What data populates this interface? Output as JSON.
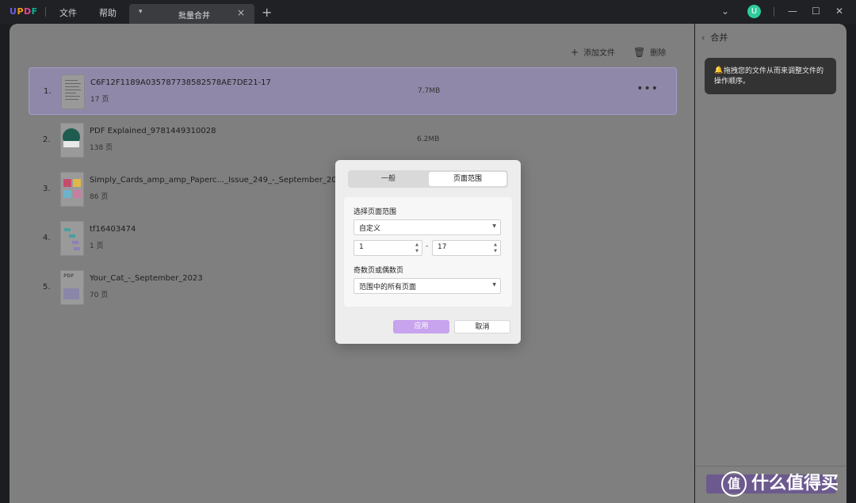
{
  "app": {
    "logo": "UPDF",
    "menus": [
      "文件",
      "帮助"
    ],
    "tab": {
      "title": "批量合并",
      "close": "×",
      "pin": "▾"
    },
    "new_tab": "+",
    "window_controls": {
      "chevron": "⌄",
      "minimize": "—",
      "maximize": "☐",
      "close": "✕"
    },
    "avatar_letter": "U"
  },
  "toolbar": {
    "add_file": "添加文件",
    "delete": "删除",
    "add_icon": "plus-icon",
    "delete_icon": "trash-icon"
  },
  "files": [
    {
      "index": "1.",
      "name": "C6F12F1189A035787738582578AE7DE21-17",
      "pages": "17 页",
      "size": "7.7MB"
    },
    {
      "index": "2.",
      "name": "PDF Explained_9781449310028",
      "pages": "138 页",
      "size": "6.2MB"
    },
    {
      "index": "3.",
      "name": "Simply_Cards_amp_amp_Paperc..._Issue_249_-_September_2023",
      "pages": "86 页",
      "size": ""
    },
    {
      "index": "4.",
      "name": "tf16403474",
      "pages": "1 页",
      "size": ""
    },
    {
      "index": "5.",
      "name": "Your_Cat_-_September_2023",
      "pages": "70 页",
      "size": ""
    }
  ],
  "more_menu": "•••",
  "right_panel": {
    "title": "合并",
    "back_icon": "‹",
    "tip": "拖拽您的文件从而来调整文件的操作顺序。"
  },
  "dialog": {
    "tabs": [
      "一般",
      "页面范围"
    ],
    "active_tab": 1,
    "range_label": "选择页面范围",
    "range_value": "自定义",
    "from": "1",
    "to": "17",
    "dash": "-",
    "odd_even_label": "奇数页或偶数页",
    "odd_even_value": "范围中的所有页面",
    "apply": "应用",
    "cancel": "取消"
  },
  "watermark": {
    "glyph": "值",
    "text": "什么值得买"
  }
}
